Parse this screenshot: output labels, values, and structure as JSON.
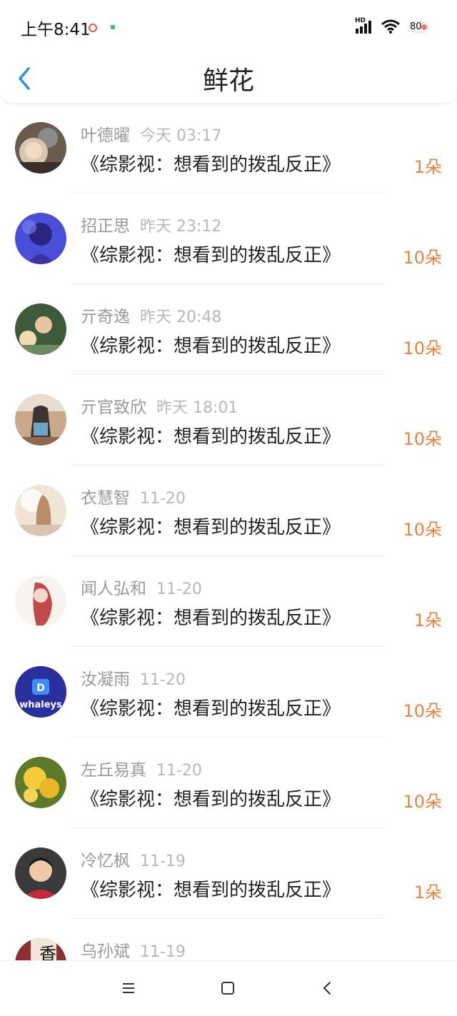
{
  "status_bar": {
    "time": "上午8:41",
    "network": "HD",
    "battery": "80"
  },
  "header": {
    "title": "鲜花",
    "back_icon": "chevron-left-icon"
  },
  "colors": {
    "accent_blue": "#2f8fe8",
    "amount_orange": "#e8823c",
    "muted_text": "#9a9a9a"
  },
  "gifts": [
    {
      "user": "叶德曜",
      "time": "今天 03:17",
      "book": "《综影视：想看到的拨乱反正》",
      "amount": "1朵"
    },
    {
      "user": "招正思",
      "time": "昨天 23:12",
      "book": "《综影视：想看到的拨乱反正》",
      "amount": "10朵"
    },
    {
      "user": "亓奇逸",
      "time": "昨天 20:48",
      "book": "《综影视：想看到的拨乱反正》",
      "amount": "10朵"
    },
    {
      "user": "亓官致欣",
      "time": "昨天 18:01",
      "book": "《综影视：想看到的拨乱反正》",
      "amount": "10朵"
    },
    {
      "user": "衣慧智",
      "time": "11-20",
      "book": "《综影视：想看到的拨乱反正》",
      "amount": "10朵"
    },
    {
      "user": "闻人弘和",
      "time": "11-20",
      "book": "《综影视：想看到的拨乱反正》",
      "amount": "1朵"
    },
    {
      "user": "汝凝雨",
      "time": "11-20",
      "book": "《综影视：想看到的拨乱反正》",
      "amount": "10朵"
    },
    {
      "user": "左丘易真",
      "time": "11-20",
      "book": "《综影视：想看到的拨乱反正》",
      "amount": "10朵"
    },
    {
      "user": "冷忆枫",
      "time": "11-19",
      "book": "《综影视：想看到的拨乱反正》",
      "amount": "1朵"
    },
    {
      "user": "乌孙斌",
      "time": "11-19",
      "book": "",
      "amount": ""
    }
  ],
  "avatar_badges": {
    "whale": "whaleys",
    "xiang": "香"
  },
  "system_nav": {
    "menu_icon": "menu-icon",
    "home_icon": "home-square-icon",
    "back_icon": "back-chevron-icon"
  }
}
